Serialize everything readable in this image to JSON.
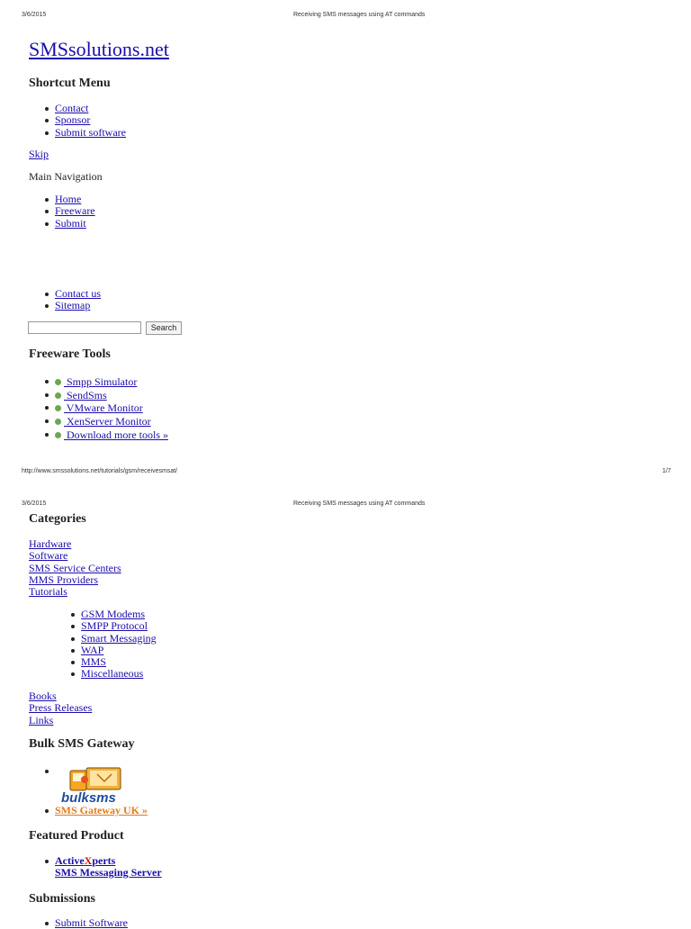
{
  "print_header": {
    "date": "3/6/2015",
    "page_title": "Receiving SMS messages using AT commands",
    "url": "http://www.smssolutions.net/tutorials/gsm/receivesmsat/",
    "page_number": "1/7"
  },
  "site_title": "SMSsolutions.net",
  "shortcut_menu": {
    "heading": "Shortcut Menu",
    "items": [
      "Contact",
      "Sponsor",
      "Submit software"
    ]
  },
  "skip_link": "Skip",
  "main_navigation": {
    "label": "Main Navigation",
    "items": [
      "Home",
      "Freeware",
      "Submit"
    ]
  },
  "secondary_links": [
    "Contact us",
    "Sitemap"
  ],
  "search": {
    "button_label": "Search",
    "value": ""
  },
  "freeware_tools": {
    "heading": "Freeware Tools",
    "items": [
      " Smpp Simulator",
      " SendSms",
      " VMware Monitor",
      " XenServer Monitor",
      " Download more tools »"
    ]
  },
  "categories": {
    "heading": "Categories",
    "items": [
      "Hardware",
      "Software",
      "SMS Service Centers",
      "MMS Providers",
      "Tutorials"
    ],
    "tutorials_sub": [
      "GSM Modems",
      "SMPP Protocol",
      "Smart Messaging",
      "WAP",
      "MMS",
      "Miscellaneous"
    ],
    "more": [
      "Books",
      "Press Releases",
      "Links"
    ]
  },
  "bulk_sms": {
    "heading": "Bulk SMS Gateway",
    "logo_text": "bulksms",
    "link": "SMS Gateway UK »"
  },
  "featured_product": {
    "heading": "Featured Product",
    "line1_a": "Active",
    "line1_b": "X",
    "line1_c": "perts",
    "line2": "SMS Messaging Server"
  },
  "submissions": {
    "heading": "Submissions",
    "first_item": "Submit Software"
  },
  "colors": {
    "link": "#1a0dab",
    "orange": "#e07b1a",
    "red": "#d01010",
    "tool_icon": "#6aa84f"
  }
}
